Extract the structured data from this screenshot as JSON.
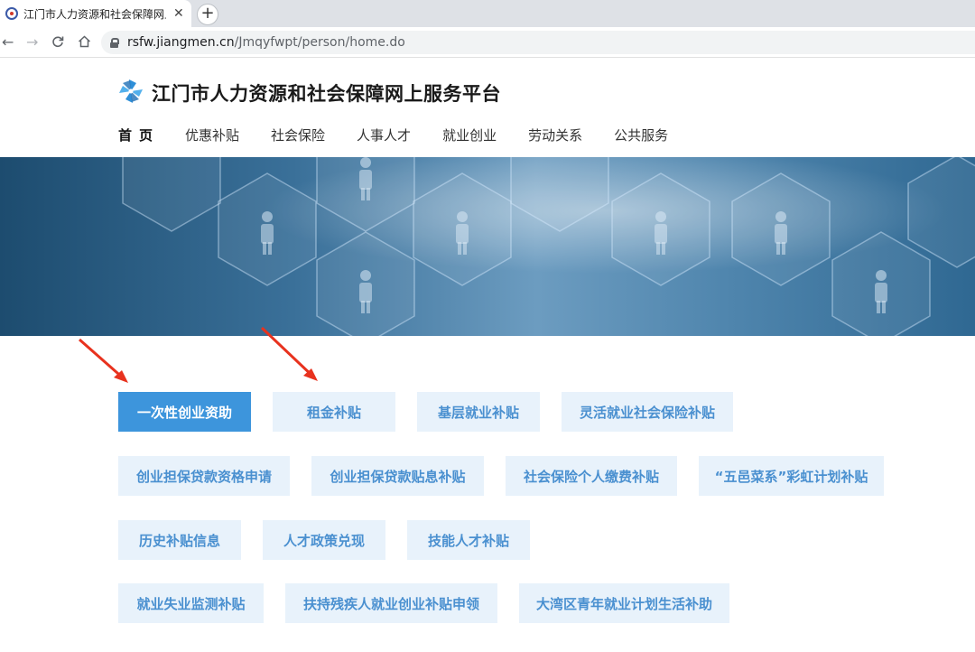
{
  "browser": {
    "tab_title": "江门市人力资源和社会保障网上服",
    "tab_close": "✕",
    "new_tab": "+",
    "url_host": "rsfw.jiangmen.cn",
    "url_path": "/Jmqyfwpt/person/home.do",
    "back_icon": "arrow-left-icon",
    "forward_icon": "arrow-right-icon",
    "reload_icon": "reload-icon",
    "home_icon": "home-icon"
  },
  "header": {
    "title": "江门市人力资源和社会保障网上服务平台",
    "nav": [
      {
        "label": "首页",
        "active": true
      },
      {
        "label": "优惠补贴"
      },
      {
        "label": "社会保险"
      },
      {
        "label": "人事人才"
      },
      {
        "label": "就业创业"
      },
      {
        "label": "劳动关系"
      },
      {
        "label": "公共服务"
      }
    ]
  },
  "services": [
    {
      "label": "一次性创业资助",
      "active": true
    },
    {
      "label": "租金补贴"
    },
    {
      "label": "基层就业补贴"
    },
    {
      "label": "灵活就业社会保险补贴"
    },
    {
      "label": "创业担保贷款资格申请"
    },
    {
      "label": "创业担保贷款贴息补贴"
    },
    {
      "label": "社会保险个人缴费补贴"
    },
    {
      "label": "“五邑菜系”彩虹计划补贴"
    },
    {
      "label": "历史补贴信息"
    },
    {
      "label": "人才政策兑现"
    },
    {
      "label": "技能人才补贴"
    },
    {
      "label": "就业失业监测补贴"
    },
    {
      "label": "扶持残疾人就业创业补贴申领"
    },
    {
      "label": "大湾区青年就业计划生活补助"
    }
  ],
  "colors": {
    "accent": "#3d95dc",
    "button_bg": "#e8f2fb",
    "button_text": "#4a90d0",
    "annotation_arrow": "#e8321e"
  }
}
